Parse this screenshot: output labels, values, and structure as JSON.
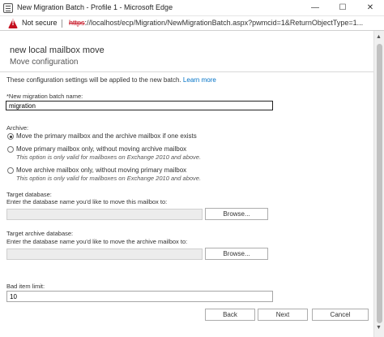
{
  "window": {
    "title": "New Migration Batch - Profile 1 - Microsoft Edge",
    "app_icon": "edge-app-icon",
    "minimize": "—",
    "maximize": "☐",
    "close": "✕"
  },
  "addressbar": {
    "warning_icon": "!",
    "not_secure": "Not secure",
    "url_scheme": "https",
    "url_rest": "://localhost/ecp/Migration/NewMigrationBatch.aspx?pwmcid=1&ReturnObjectType=1..."
  },
  "header": {
    "title": "new local mailbox move",
    "subtitle": "Move configuration"
  },
  "intro": {
    "text": "These configuration settings will be applied to the new batch. ",
    "link": "Learn more"
  },
  "batch_name": {
    "label": "*New migration batch name:",
    "value": "migration"
  },
  "archive": {
    "label": "Archive:",
    "options": [
      {
        "label": "Move the primary mailbox and the archive mailbox if one exists",
        "note": "",
        "checked": true
      },
      {
        "label": "Move primary mailbox only, without moving archive mailbox",
        "note": "This option is only valid for mailboxes on Exchange 2010 and above.",
        "checked": false
      },
      {
        "label": "Move archive mailbox only, without moving primary mailbox",
        "note": "This option is only valid for mailboxes on Exchange 2010 and above.",
        "checked": false
      }
    ]
  },
  "target_database": {
    "label": "Target database:",
    "hint": "Enter the database name you'd like to move this mailbox to:",
    "value": "",
    "browse": "Browse..."
  },
  "target_archive_database": {
    "label": "Target archive database:",
    "hint": "Enter the database name you'd like to move the archive mailbox to:",
    "value": "",
    "browse": "Browse..."
  },
  "bad_item_limit": {
    "label": "Bad item limit:",
    "value": "10"
  },
  "footer": {
    "back": "Back",
    "next": "Next",
    "cancel": "Cancel"
  },
  "scrollbar": {
    "up": "▲",
    "down": "▼"
  }
}
